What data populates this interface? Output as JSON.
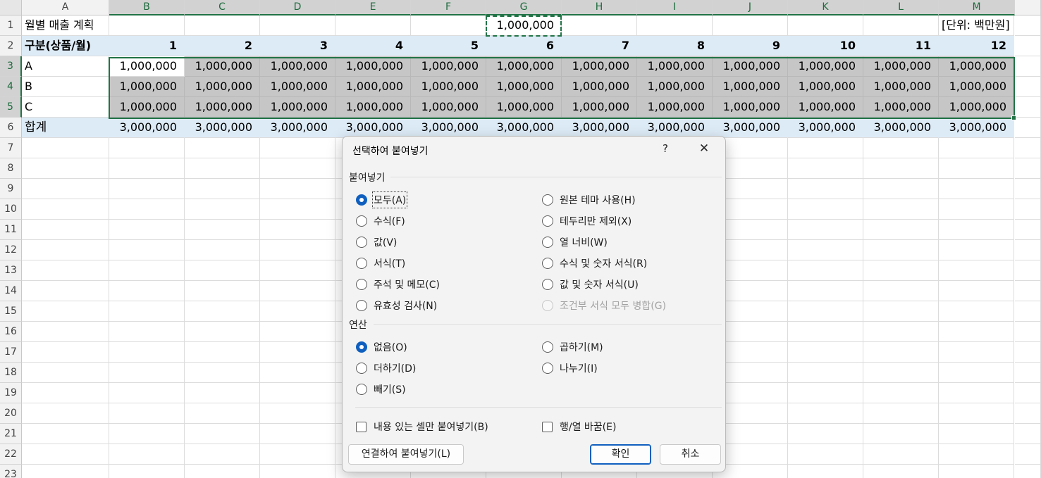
{
  "sheet": {
    "columns": [
      "A",
      "B",
      "C",
      "D",
      "E",
      "F",
      "G",
      "H",
      "I",
      "J",
      "K",
      "L",
      "M"
    ],
    "rows": [
      "1",
      "2",
      "3",
      "4",
      "5",
      "6",
      "7",
      "8",
      "9",
      "10",
      "11",
      "12",
      "13",
      "14",
      "15",
      "16",
      "17",
      "18",
      "19",
      "20",
      "21",
      "22",
      "23"
    ],
    "title": "월별 매출 계획",
    "copied_value": "1,000,000",
    "unit_label": "[단위: 백만원]",
    "header_label": "구분(상품/월)",
    "months": [
      "1",
      "2",
      "3",
      "4",
      "5",
      "6",
      "7",
      "8",
      "9",
      "10",
      "11",
      "12"
    ],
    "products": [
      {
        "name": "A",
        "values": [
          "1,000,000",
          "1,000,000",
          "1,000,000",
          "1,000,000",
          "1,000,000",
          "1,000,000",
          "1,000,000",
          "1,000,000",
          "1,000,000",
          "1,000,000",
          "1,000,000",
          "1,000,000"
        ]
      },
      {
        "name": "B",
        "values": [
          "1,000,000",
          "1,000,000",
          "1,000,000",
          "1,000,000",
          "1,000,000",
          "1,000,000",
          "1,000,000",
          "1,000,000",
          "1,000,000",
          "1,000,000",
          "1,000,000",
          "1,000,000"
        ]
      },
      {
        "name": "C",
        "values": [
          "1,000,000",
          "1,000,000",
          "1,000,000",
          "1,000,000",
          "1,000,000",
          "1,000,000",
          "1,000,000",
          "1,000,000",
          "1,000,000",
          "1,000,000",
          "1,000,000",
          "1,000,000"
        ]
      }
    ],
    "total_label": "합계",
    "totals": [
      "3,000,000",
      "3,000,000",
      "3,000,000",
      "3,000,000",
      "3,000,000",
      "3,000,000",
      "3,000,000",
      "3,000,000",
      "3,000,000",
      "3,000,000",
      "3,000,000",
      "3,000,000"
    ],
    "accent_color": "#217346",
    "header_fill": "#ddebf7",
    "selection_fill": "#c6c6c6"
  },
  "dialog": {
    "title": "선택하여 붙여넣기",
    "help": "?",
    "close": "✕",
    "paste_group": "붙여넣기",
    "paste_options": [
      {
        "label": "모두(A)",
        "checked": true
      },
      {
        "label": "수식(F)"
      },
      {
        "label": "값(V)"
      },
      {
        "label": "서식(T)"
      },
      {
        "label": "주석 및 메모(C)"
      },
      {
        "label": "유효성 검사(N)"
      },
      {
        "label": "원본 테마 사용(H)"
      },
      {
        "label": "테두리만 제외(X)"
      },
      {
        "label": "열 너비(W)"
      },
      {
        "label": "수식 및 숫자 서식(R)"
      },
      {
        "label": "값 및 숫자 서식(U)"
      },
      {
        "label": "조건부 서식 모두 병합(G)",
        "disabled": true
      }
    ],
    "operation_group": "연산",
    "operation_options": [
      {
        "label": "없음(O)",
        "checked": true
      },
      {
        "label": "더하기(D)"
      },
      {
        "label": "빼기(S)"
      },
      {
        "label": "곱하기(M)"
      },
      {
        "label": "나누기(I)"
      }
    ],
    "skip_blanks": "내용 있는 셀만 붙여넣기(B)",
    "transpose": "행/열 바꿈(E)",
    "paste_link_button": "연결하여 붙여넣기(L)",
    "ok_button": "확인",
    "cancel_button": "취소",
    "primary_color": "#0f5fbf"
  }
}
